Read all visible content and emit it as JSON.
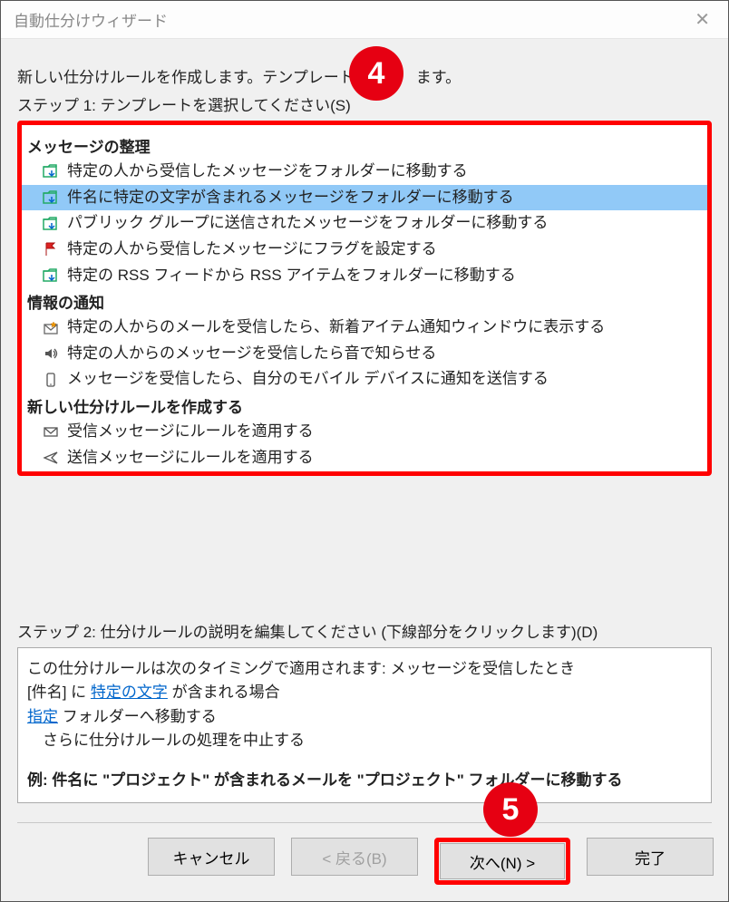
{
  "title": "自動仕分けウィザード",
  "intro_left": "新しい仕分けルールを作成します。テンプレートを",
  "intro_right": "ます。",
  "step1_label": "ステップ 1: テンプレートを選択してください(S)",
  "sections": {
    "organize": {
      "header": "メッセージの整理",
      "items": [
        "特定の人から受信したメッセージをフォルダーに移動する",
        "件名に特定の文字が含まれるメッセージをフォルダーに移動する",
        "パブリック グループに送信されたメッセージをフォルダーに移動する",
        "特定の人から受信したメッセージにフラグを設定する",
        "特定の RSS フィードから RSS アイテムをフォルダーに移動する"
      ]
    },
    "notify": {
      "header": "情報の通知",
      "items": [
        "特定の人からのメールを受信したら、新着アイテム通知ウィンドウに表示する",
        "特定の人からのメッセージを受信したら音で知らせる",
        "メッセージを受信したら、自分のモバイル デバイスに通知を送信する"
      ]
    },
    "create": {
      "header": "新しい仕分けルールを作成する",
      "items": [
        "受信メッセージにルールを適用する",
        "送信メッセージにルールを適用する"
      ]
    }
  },
  "step2_label": "ステップ 2: 仕分けルールの説明を編集してください (下線部分をクリックします)(D)",
  "desc": {
    "line1": "この仕分けルールは次のタイミングで適用されます: メッセージを受信したとき",
    "line2a": "[件名] に ",
    "line2_link": "特定の文字",
    "line2b": " が含まれる場合",
    "line3_link": "指定",
    "line3b": " フォルダーへ移動する",
    "line4": "　さらに仕分けルールの処理を中止する",
    "example": "例: 件名に \"プロジェクト\" が含まれるメールを \"プロジェクト\" フォルダーに移動する"
  },
  "buttons": {
    "cancel": "キャンセル",
    "back": "< 戻る(B)",
    "next": "次へ(N) >",
    "finish": "完了"
  },
  "callouts": {
    "c4": "4",
    "c5": "5"
  }
}
